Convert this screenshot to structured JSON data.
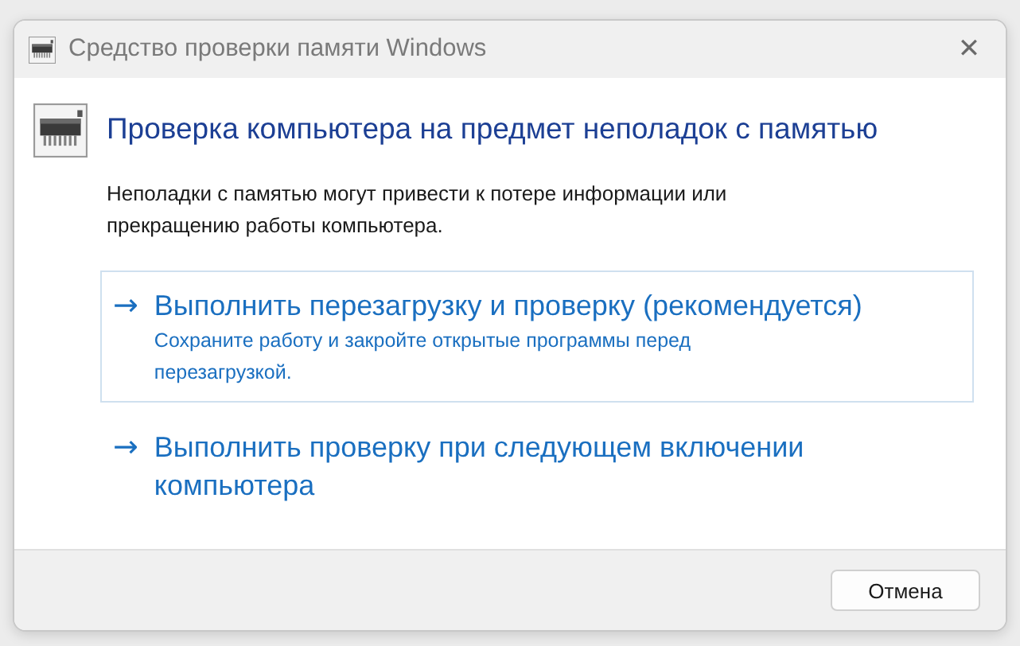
{
  "window": {
    "title": "Средство проверки памяти Windows",
    "close": "✕"
  },
  "heading": "Проверка компьютера на предмет неполадок с памятью",
  "description": "Неполадки с памятью могут привести к потере информации или прекращению работы компьютера.",
  "options": [
    {
      "arrow": "→",
      "title": "Выполнить перезагрузку и проверку (рекомендуется)",
      "subtitle": "Сохраните работу и закройте открытые программы перед перезагрузкой.",
      "selected": true
    },
    {
      "arrow": "→",
      "title": "Выполнить проверку при следующем включении компьютера",
      "selected": false
    }
  ],
  "buttons": [
    "Отмена"
  ]
}
